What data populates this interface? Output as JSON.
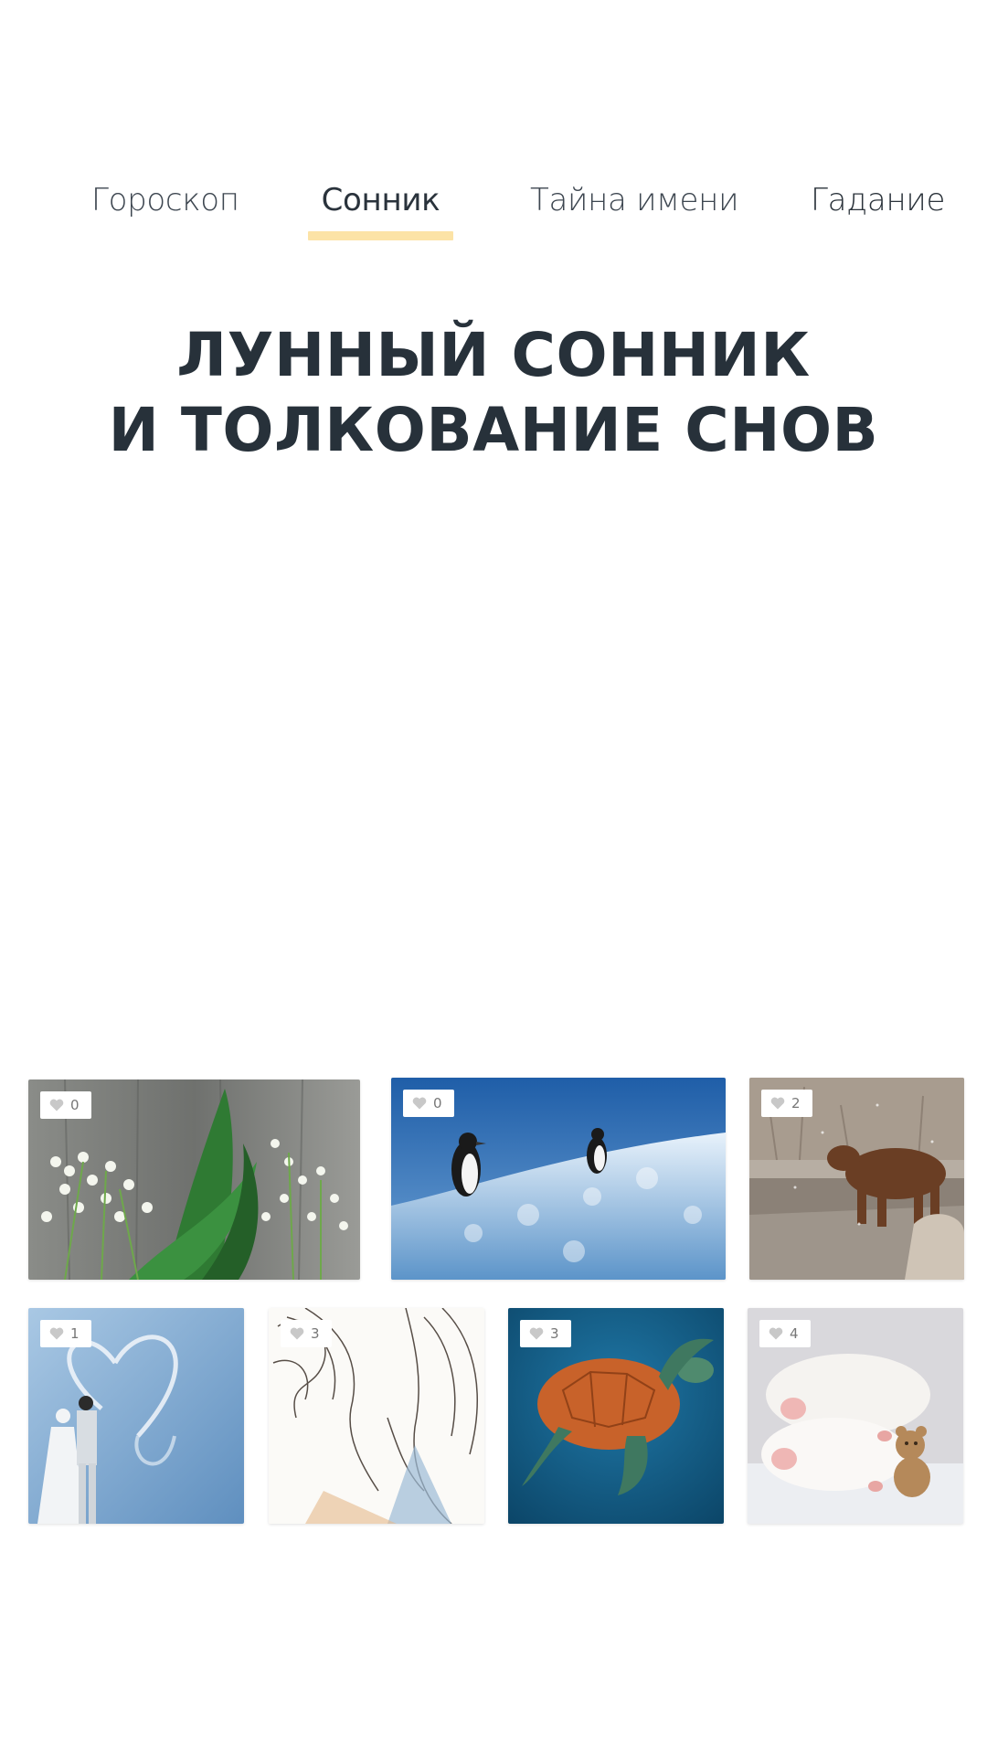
{
  "nav": {
    "items": [
      {
        "label": "Гороскоп",
        "active": false
      },
      {
        "label": "Сонник",
        "active": true
      },
      {
        "label": "Тайна имени",
        "active": false
      },
      {
        "label": "Гадание",
        "active": false
      }
    ],
    "active_underline_color": "#fce3a6"
  },
  "title": {
    "line1": "ЛУННЫЙ СОННИК",
    "line2": "И ТОЛКОВАНИЕ СНОВ"
  },
  "gallery": {
    "tiles": [
      {
        "image": "lily-of-the-valley-photo",
        "likes": "0"
      },
      {
        "image": "penguins-on-ice-photo",
        "likes": "0"
      },
      {
        "image": "cow-in-snow-photo",
        "likes": "2"
      },
      {
        "image": "wedding-couple-heart-sky-photo",
        "likes": "1"
      },
      {
        "image": "sketch-couple-photo",
        "likes": "3"
      },
      {
        "image": "sea-turtle-photo",
        "likes": "3"
      },
      {
        "image": "white-rats-with-teddy-photo",
        "likes": "4"
      }
    ]
  }
}
